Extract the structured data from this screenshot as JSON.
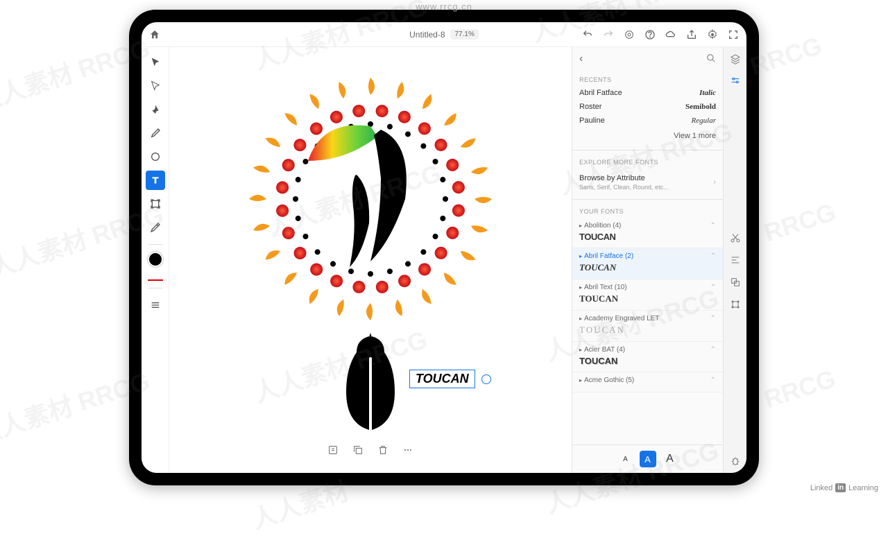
{
  "url_watermark": "www.rrcg.cn",
  "watermark_text": "人人素材 RRCG",
  "linkedin": "Linked in Learning",
  "topbar": {
    "title": "Untitled-8",
    "zoom": "77.1%"
  },
  "canvas": {
    "text_content": "TOUCAN"
  },
  "panel": {
    "recents_label": "RECENTS",
    "recents": [
      {
        "name": "Abril Fatface",
        "style": "Italic",
        "style_css": "font-style:italic;font-weight:bold"
      },
      {
        "name": "Roster",
        "style": "Semibold",
        "style_css": "font-weight:bold"
      },
      {
        "name": "Pauline",
        "style": "Regular",
        "style_css": "font-style:italic;font-family:cursive"
      }
    ],
    "view_more": "View 1 more",
    "explore_label": "EXPLORE MORE FONTS",
    "browse_title": "Browse by Attribute",
    "browse_sub": "Sans, Serif, Clean, Round, etc...",
    "your_fonts_label": "YOUR FONTS",
    "fonts": [
      {
        "name": "Abolition (4)",
        "preview": "TOUCAN",
        "cls": "",
        "pstyle": "font-family:Impact,sans-serif;font-stretch:condensed;letter-spacing:-0.5px"
      },
      {
        "name": "Abril Fatface (2)",
        "preview": "TOUCAN",
        "cls": "selected",
        "pstyle": ""
      },
      {
        "name": "Abril Text (10)",
        "preview": "TOUCAN",
        "cls": "",
        "pstyle": "font-family:Georgia,serif;font-weight:bold"
      },
      {
        "name": "Academy Engraved LET",
        "preview": "TOUCAN",
        "cls": "engraved",
        "pstyle": ""
      },
      {
        "name": "Acier BAT (4)",
        "preview": "TOUCAN",
        "cls": "",
        "pstyle": "font-weight:bold;text-shadow:1px 1px 0 #ccc"
      },
      {
        "name": "Acme Gothic (5)",
        "preview": "",
        "cls": "",
        "pstyle": ""
      }
    ],
    "size_letter": "A"
  }
}
